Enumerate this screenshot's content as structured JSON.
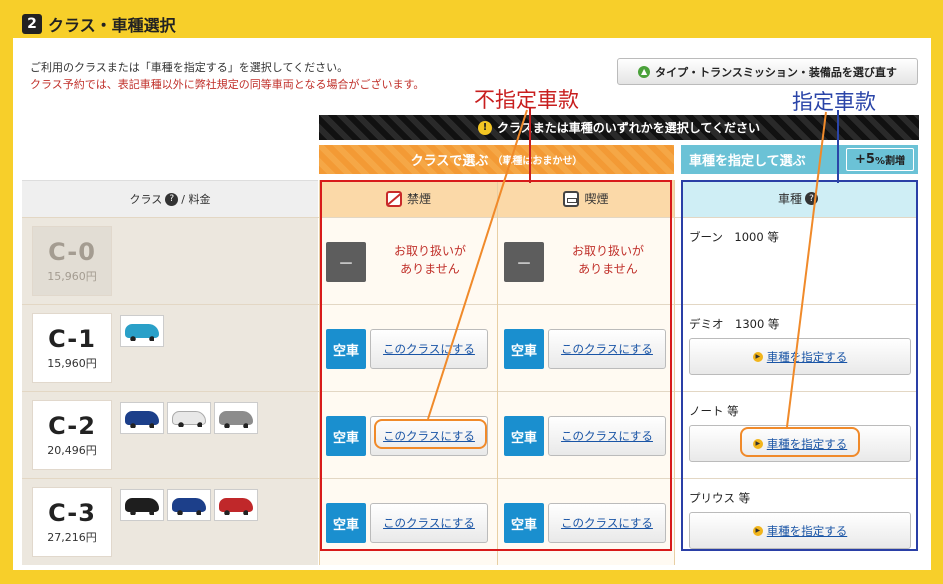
{
  "header": {
    "step": "2",
    "title": "クラス・車種選択"
  },
  "intro": {
    "line1": "ご利用のクラスまたは「車種を指定する」を選択してください。",
    "line2": "クラス予約では、表記車種以外に弊社規定の同等車両となる場合がございます。"
  },
  "reselect_button": "タイプ・トランスミッション・装備品を選び直す",
  "annotations": {
    "unspecified": "不指定車款",
    "specified": "指定車款"
  },
  "notice_bar": "クラスまたは車種のいずれかを選択してください",
  "tabs": {
    "by_class": "クラスで選ぶ",
    "by_class_note": "（車種はおまかせ）",
    "by_car": "車種を指定して選ぶ",
    "surcharge_big": "+5",
    "surcharge_small": "%割増"
  },
  "columns": {
    "class_label": "クラス",
    "price_label": "/ 料金",
    "nonsmoking": "禁煙",
    "smoking": "喫煙",
    "car_model": "車種"
  },
  "labels": {
    "vacant": "空車",
    "select_class": "このクラスにする",
    "specify_car": "車種を指定する",
    "unavailable_line1": "お取り扱いが",
    "unavailable_line2": "ありません",
    "unavailable_mark": "－"
  },
  "rows": [
    {
      "class": "C-0",
      "price": "15,960円",
      "available": false,
      "model": "ブーン　1000 等",
      "cars": []
    },
    {
      "class": "C-1",
      "price": "15,960円",
      "available": true,
      "model": "デミオ　1300 等",
      "cars": [
        "#2aa0c8"
      ]
    },
    {
      "class": "C-2",
      "price": "20,496円",
      "available": true,
      "model": "ノート 等",
      "cars": [
        "#1c3f8a",
        "#e8e8e8",
        "#8c8c8c"
      ]
    },
    {
      "class": "C-3",
      "price": "27,216円",
      "available": true,
      "model": "プリウス 等",
      "cars": [
        "#1e1e1e",
        "#1c3f8a",
        "#c0282a"
      ]
    }
  ]
}
